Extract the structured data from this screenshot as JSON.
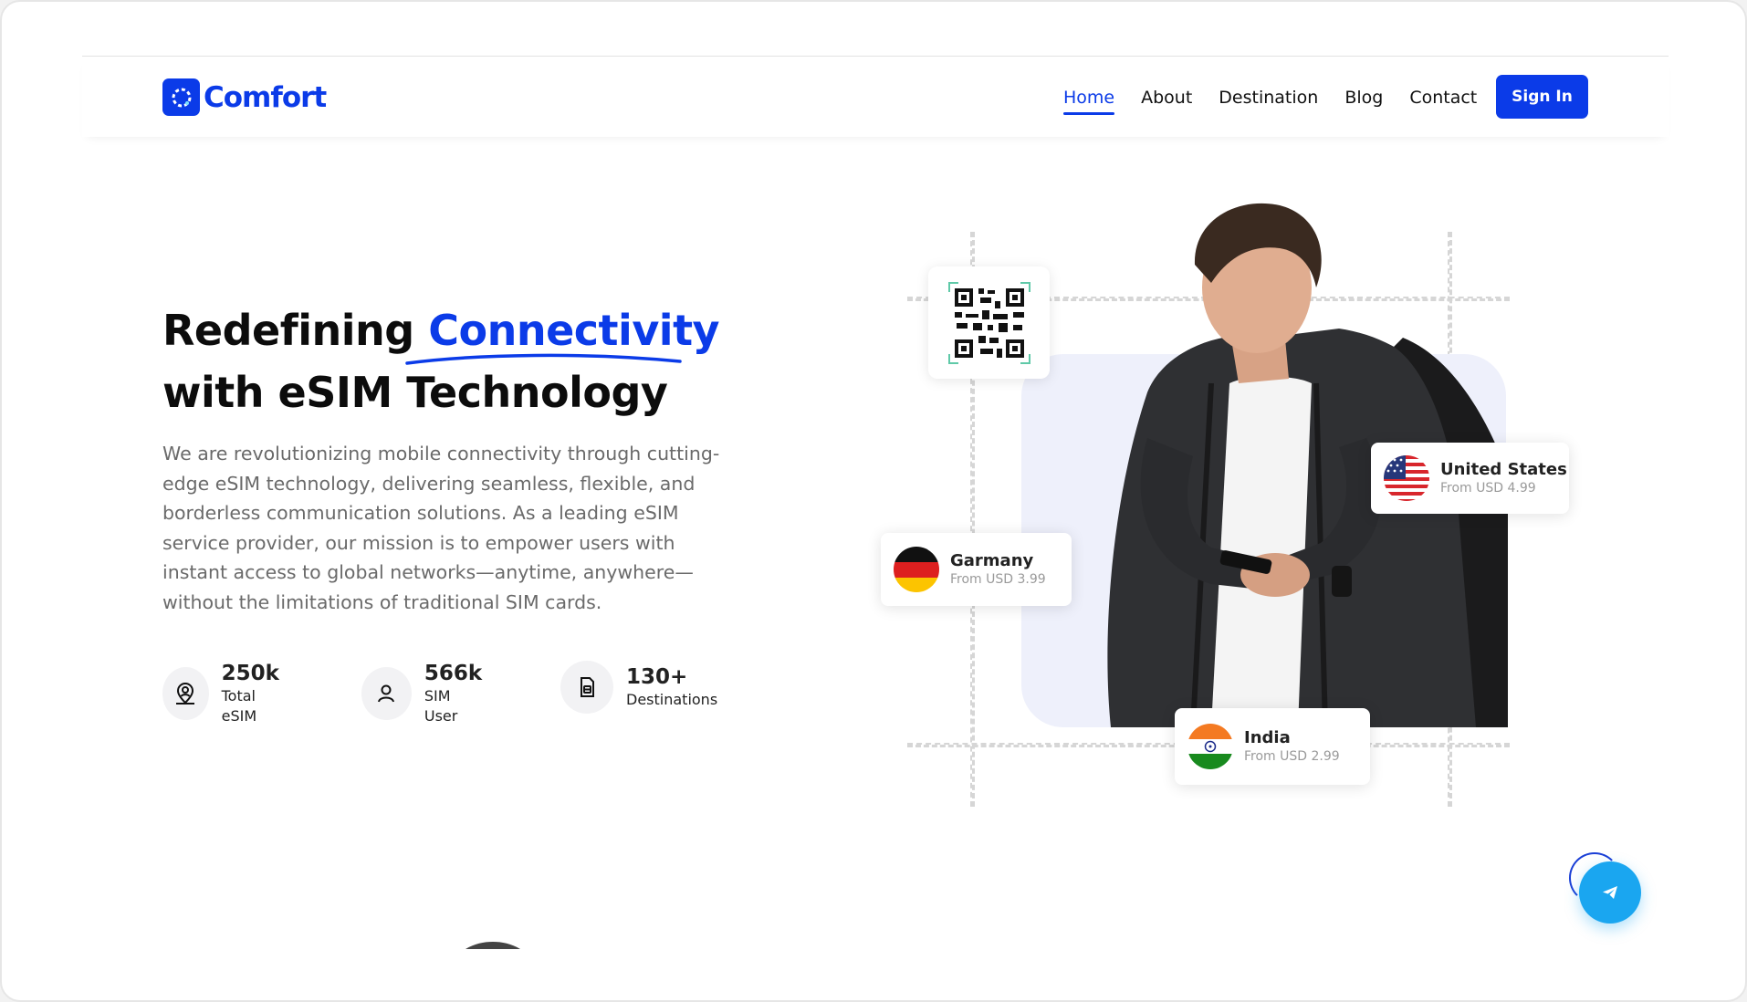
{
  "brand": {
    "name": "Comfort",
    "color": "#0b3be8",
    "icon": "comfort-logo-icon"
  },
  "nav": {
    "items": [
      {
        "label": "Home",
        "active": true
      },
      {
        "label": "About",
        "active": false
      },
      {
        "label": "Destination",
        "active": false
      },
      {
        "label": "Blog",
        "active": false
      },
      {
        "label": "Contact",
        "active": false
      }
    ],
    "signin_label": "Sign In"
  },
  "hero": {
    "headline_pre": "Redefining ",
    "headline_accent": "Connectivity",
    "headline_post": "with eSIM Technology",
    "description": "We are revolutionizing mobile connectivity through cutting-edge eSIM technology, delivering seamless, flexible, and borderless communication solutions. As a leading eSIM service provider, our mission is to empower users with instant access to global networks—anytime, anywhere—without the limitations of traditional SIM cards."
  },
  "stats": [
    {
      "value": "250k",
      "label": "Total eSIM",
      "icon": "map-pin-user-icon"
    },
    {
      "value": "566k",
      "label": "SIM User",
      "icon": "user-icon"
    },
    {
      "value": "130+",
      "label": "Destinations",
      "icon": "sim-card-icon"
    }
  ],
  "destinations": [
    {
      "name": "United States",
      "price": "From USD 4.99",
      "icon": "us-flag-icon"
    },
    {
      "name": "Garmany",
      "price": "From USD 3.99",
      "icon": "germany-flag-icon"
    },
    {
      "name": "India",
      "price": "From USD 2.99",
      "icon": "india-flag-icon"
    }
  ],
  "qr_icon": "qr-code-icon",
  "chat_icon": "telegram-send-icon"
}
